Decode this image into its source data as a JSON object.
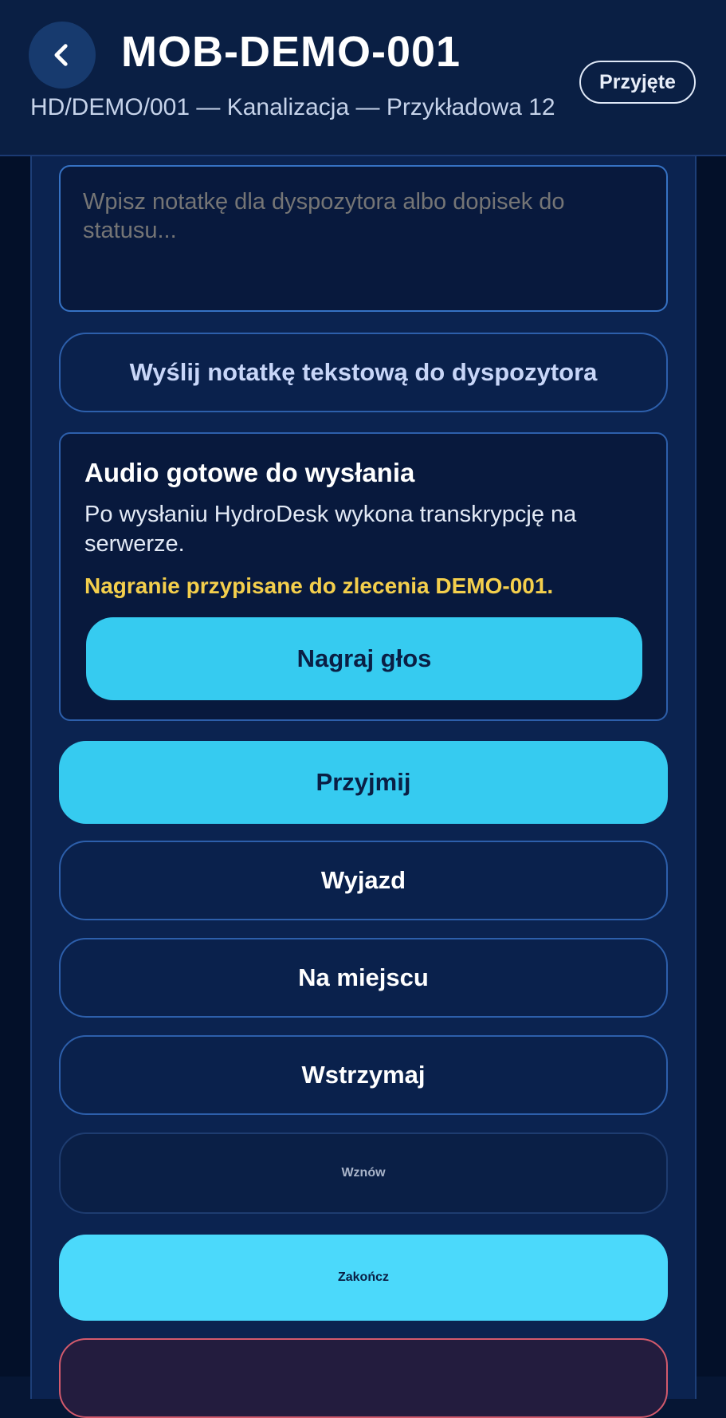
{
  "header": {
    "title": "MOB-DEMO-001",
    "subtitle": "HD/DEMO/001 — Kanalizacja — Przykładowa 12",
    "status_badge": "Przyjęte"
  },
  "note": {
    "placeholder": "Wpisz notatkę dla dyspozytora albo dopisek do statusu...",
    "send_label": "Wyślij notatkę tekstową do dyspozytora"
  },
  "audio": {
    "title": "Audio gotowe do wysłania",
    "description": "Po wysłaniu HydroDesk wykona transkrypcję na serwerze.",
    "warning": "Nagranie przypisane do zlecenia DEMO-001.",
    "record_label": "Nagraj głos"
  },
  "actions": {
    "accept": "Przyjmij",
    "depart": "Wyjazd",
    "on_site": "Na miejscu",
    "pause": "Wstrzymaj",
    "resume": "Wznów",
    "finish": "Zakończ"
  },
  "colors": {
    "accent": "#36cbf0",
    "background": "#061634",
    "card": "#0b2350",
    "warning": "#f4cf4c",
    "danger": "#d35a6c"
  },
  "icons": {
    "back": "chevron-left-icon"
  }
}
